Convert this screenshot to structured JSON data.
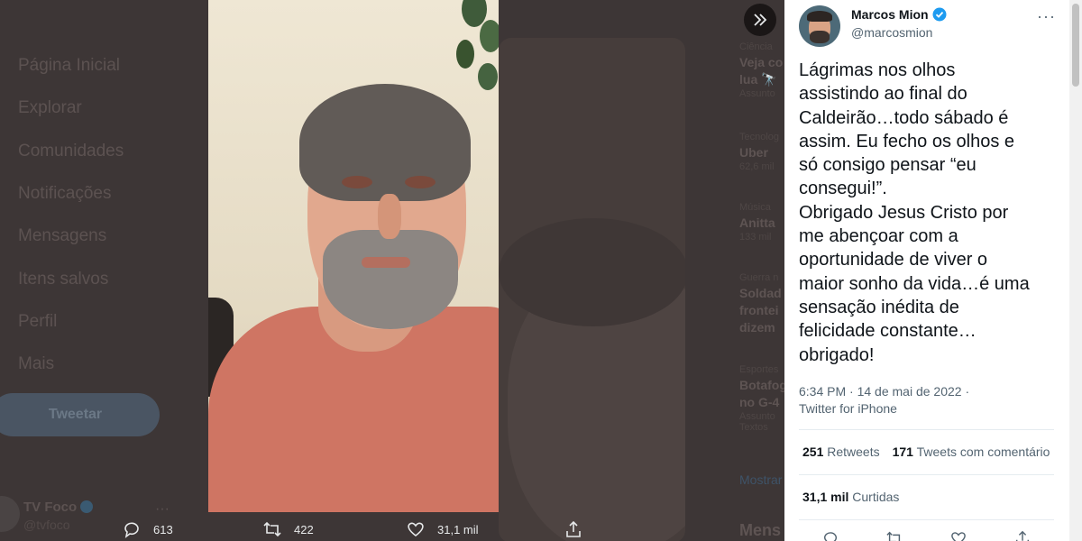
{
  "nav": {
    "items": [
      {
        "label": "Página Inicial"
      },
      {
        "label": "Explorar"
      },
      {
        "label": "Comunidades"
      },
      {
        "label": "Notificações"
      },
      {
        "label": "Mensagens"
      },
      {
        "label": "Itens salvos"
      },
      {
        "label": "Perfil"
      },
      {
        "label": "Mais"
      }
    ],
    "tweet_button": "Tweetar",
    "account": {
      "name": "TV Foco",
      "handle": "@tvfoco"
    }
  },
  "trends": [
    {
      "category": "Ciência",
      "title": "Veja co lua 🔭",
      "count": "Assunto"
    },
    {
      "category": "Tecnolog",
      "title": "Uber",
      "count": "62,6 mil"
    },
    {
      "category": "Música",
      "title": "Anitta",
      "count": "133 mil"
    },
    {
      "category": "Guerra n",
      "title": "Soldad frontei dizem a",
      "count": ""
    },
    {
      "category": "Esportes",
      "title": "Botafog no G-4",
      "count": "Assunto Textos"
    }
  ],
  "trends_show_more": "Mostrar",
  "trends_side_title": "Mens",
  "viewer_actions": {
    "replies": "613",
    "retweets": "422",
    "likes": "31,1 mil"
  },
  "tweet": {
    "author_name": "Marcos Mion",
    "author_handle": "@marcosmion",
    "text": "Lágrimas nos olhos\nassistindo ao final do\nCaldeirão…todo sábado é\nassim. Eu fecho os olhos e\nsó consigo pensar “eu\nconsegui!”.\nObrigado Jesus Cristo por\nme abençoar com a\noportunidade de viver o\nmaior sonho da vida…é uma\nsensação inédita de\nfelicidade constante…\nobrigado!",
    "time": "6:34 PM · 14 de mai de 2022 ·",
    "source": "Twitter for iPhone",
    "retweets_count": "251",
    "retweets_label": "Retweets",
    "quotes_count": "171",
    "quotes_label": "Tweets com comentário",
    "likes_count": "31,1 mil",
    "likes_label": "Curtidas"
  },
  "colors": {
    "accent": "#1d9bf0",
    "overlay": "#3d3636",
    "text": "#0f1419",
    "muted": "#536471"
  }
}
